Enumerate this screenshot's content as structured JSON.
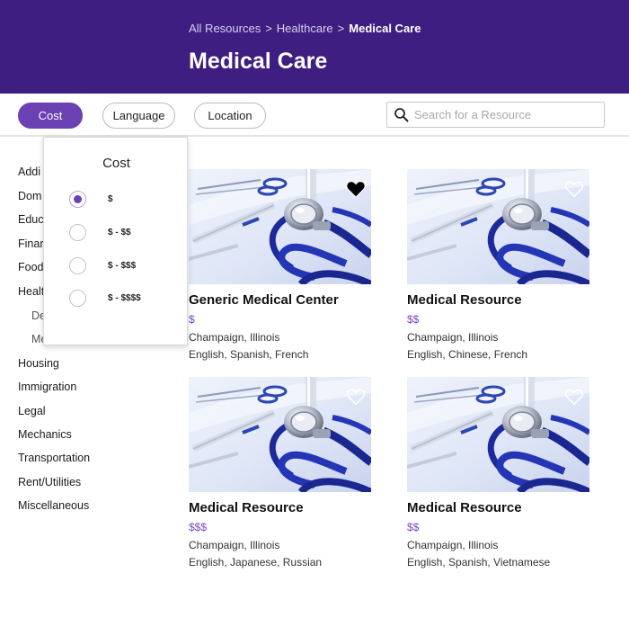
{
  "header": {
    "breadcrumb": [
      "All Resources",
      "Healthcare",
      "Medical Care"
    ],
    "separator": ">",
    "title": "Medical Care"
  },
  "filters": {
    "cost_label": "Cost",
    "language_label": "Language",
    "location_label": "Location",
    "search_placeholder": "Search for a Resource"
  },
  "cost_dropdown": {
    "title": "Cost",
    "options": [
      "$",
      "$ - $$",
      "$ - $$$",
      "$ - $$$$"
    ],
    "selected": "$"
  },
  "sidebar": {
    "categories": [
      "Addi",
      "Dom",
      "Educ",
      "Finar",
      "Food",
      "Healt",
      "De",
      "Me",
      "Housing",
      "Immigration",
      "Legal",
      "Mechanics",
      "Transportation",
      "Rent/Utilities",
      "Miscellaneous"
    ]
  },
  "resources": [
    {
      "title": "Generic Medical Center",
      "cost": "$",
      "location": "Champaign, Illinois",
      "languages": "English, Spanish, French",
      "favorited": true
    },
    {
      "title": "Medical Resource",
      "cost": "$$",
      "location": "Champaign, Illinois",
      "languages": "English, Chinese, French",
      "favorited": false
    },
    {
      "title": "Medical Resource",
      "cost": "$$$",
      "location": "Champaign, Illinois",
      "languages": "English, Japanese, Russian",
      "favorited": false
    },
    {
      "title": "Medical Resource",
      "cost": "$$",
      "location": "Champaign, Illinois",
      "languages": "English, Spanish, Vietnamese",
      "favorited": false
    }
  ],
  "colors": {
    "header_bg": "#3f1e82",
    "accent": "#6a40b3",
    "cost_text": "#7a45c2"
  }
}
